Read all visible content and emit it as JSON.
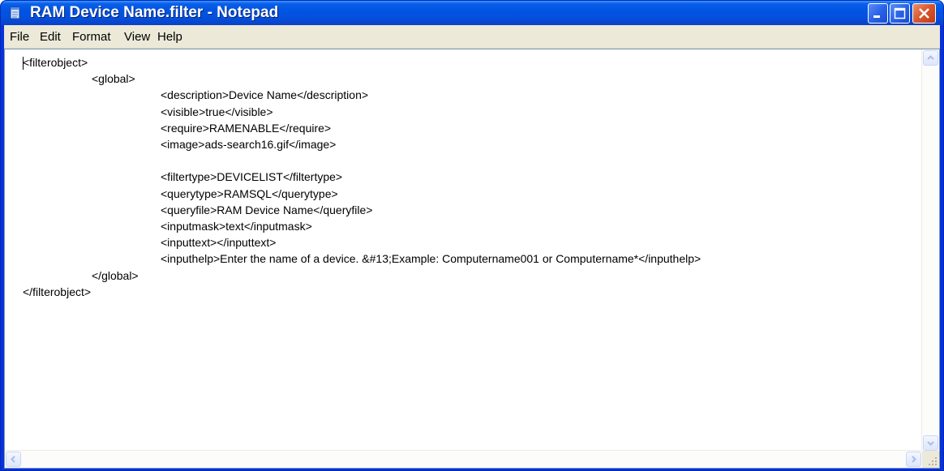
{
  "window": {
    "title": "RAM Device Name.filter - Notepad"
  },
  "menu": {
    "items": [
      "File",
      "Edit",
      "Format",
      "View",
      "Help"
    ]
  },
  "document": {
    "lines": [
      "<filterobject>",
      "\t<global>",
      "\t\t<description>Device Name</description>",
      "\t\t<visible>true</visible>",
      "\t\t<require>RAMENABLE</require>",
      "\t\t<image>ads-search16.gif</image>",
      "",
      "\t\t<filtertype>DEVICELIST</filtertype>",
      "\t\t<querytype>RAMSQL</querytype>",
      "\t\t<queryfile>RAM Device Name</queryfile>",
      "\t\t<inputmask>text</inputmask>",
      "\t\t<inputtext></inputtext>",
      "\t\t<inputhelp>Enter the name of a device. &#13;Example: Computername001 or Computername*</inputhelp>",
      "\t</global>",
      "</filterobject>"
    ]
  },
  "colors": {
    "titlebar": "#0054e3",
    "close_button": "#d9552c",
    "menubar": "#ece9d8"
  },
  "icons": {
    "app": "notepad-icon",
    "minimize": "minimize-icon",
    "maximize": "maximize-icon",
    "close": "close-icon",
    "scroll_up": "chevron-up-icon",
    "scroll_down": "chevron-down-icon",
    "scroll_left": "chevron-left-icon",
    "scroll_right": "chevron-right-icon",
    "grip": "resize-grip-icon"
  }
}
